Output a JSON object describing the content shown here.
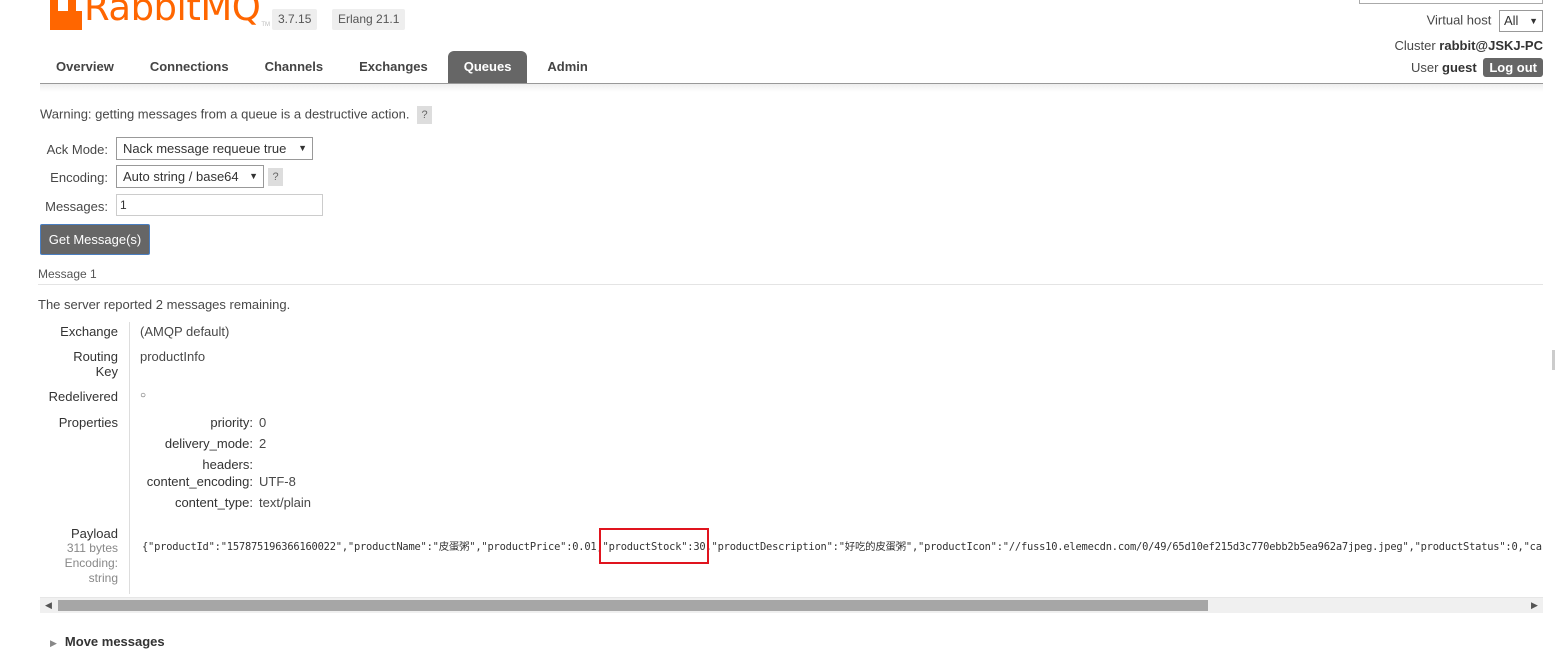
{
  "header": {
    "logo_text": "RabbitMQ",
    "logo_tm": "TM",
    "version": "3.7.15",
    "erlang": "Erlang 21.1",
    "virtual_host_label": "Virtual host",
    "virtual_host_value": "All",
    "cluster_label": "Cluster",
    "cluster_value": "rabbit@JSKJ-PC",
    "user_label": "User",
    "user_value": "guest",
    "logout_label": "Log out"
  },
  "nav": {
    "tabs": [
      {
        "label": "Overview",
        "active": false
      },
      {
        "label": "Connections",
        "active": false
      },
      {
        "label": "Channels",
        "active": false
      },
      {
        "label": "Exchanges",
        "active": false
      },
      {
        "label": "Queues",
        "active": true
      },
      {
        "label": "Admin",
        "active": false
      }
    ]
  },
  "get_messages": {
    "warning": "Warning: getting messages from a queue is a destructive action.",
    "help": "?",
    "ack_mode_label": "Ack Mode:",
    "ack_mode_value": "Nack message requeue true",
    "encoding_label": "Encoding:",
    "encoding_value": "Auto string / base64",
    "messages_label": "Messages:",
    "messages_value": "1",
    "button_label": "Get Message(s)"
  },
  "message": {
    "title": "Message 1",
    "server_reported_pre": "The server reported",
    "remaining_count": "2",
    "server_reported_post": "messages remaining.",
    "exchange_label": "Exchange",
    "exchange_value": "(AMQP default)",
    "routing_key_label_1": "Routing",
    "routing_key_label_2": "Key",
    "routing_key_value": "productInfo",
    "redelivered_label": "Redelivered",
    "redelivered_value": "○",
    "properties_label": "Properties",
    "properties": [
      {
        "key": "priority:",
        "value": "0"
      },
      {
        "key": "delivery_mode:",
        "value": "2"
      },
      {
        "key": "headers:",
        "value": ""
      },
      {
        "key": "content_encoding:",
        "value": "UTF-8"
      },
      {
        "key": "content_type:",
        "value": "text/plain"
      }
    ],
    "payload_label": "Payload",
    "payload_size": "311 bytes",
    "payload_encoding_label": "Encoding:",
    "payload_encoding_value": "string",
    "payload_text": "{\"productId\":\"157875196366160022\",\"productName\":\"皮蛋粥\",\"productPrice\":0.01,\"productStock\":30,\"productDescription\":\"好吃的皮蛋粥\",\"productIcon\":\"//fuss10.elemecdn.com/0/49/65d10ef215d3c770ebb2b5ea962a7jpeg.jpeg\",\"productStatus\":0,\"ca"
  },
  "footer": {
    "move_messages": "Move messages"
  }
}
